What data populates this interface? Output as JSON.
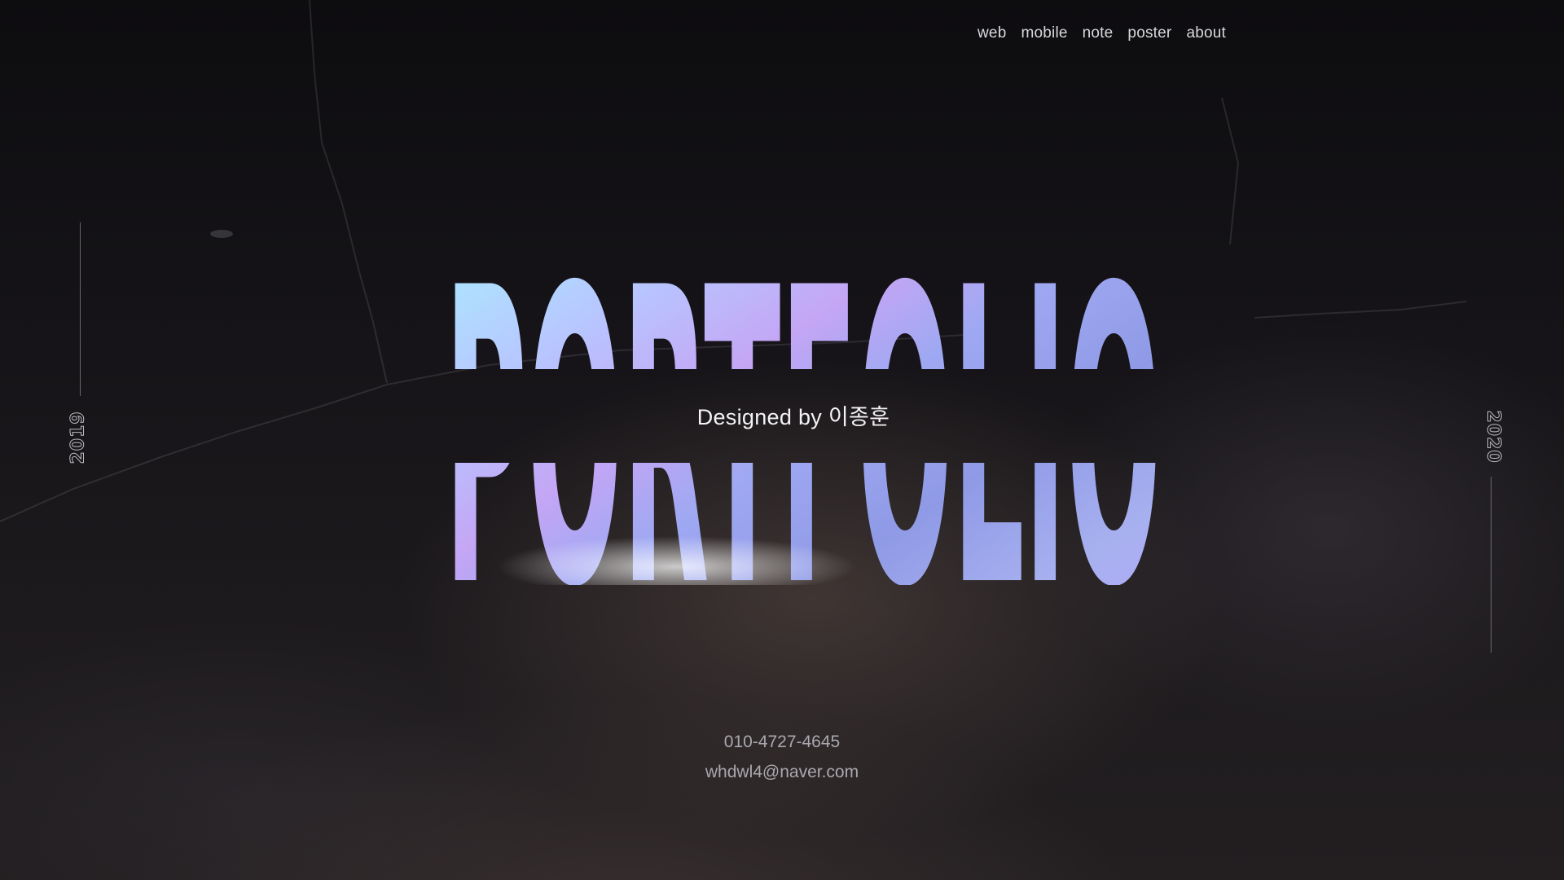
{
  "nav": {
    "items": [
      {
        "label": "web"
      },
      {
        "label": "mobile"
      },
      {
        "label": "note"
      },
      {
        "label": "poster"
      },
      {
        "label": "about"
      }
    ]
  },
  "hero": {
    "title": "PORTFOLIO",
    "subtitle": "Designed by 이종훈",
    "year_start": "2019",
    "year_end": "2020"
  },
  "contact": {
    "phone": "010-4727-4645",
    "email": "whdwl4@naver.com"
  },
  "colors": {
    "background": "#141215",
    "title_gradient": [
      "#a8f4ff",
      "#9fa8f2",
      "#c4a6f5",
      "#e8eef0",
      "#b7a9ff"
    ],
    "nav_text": "#d8d8dc",
    "contact_text": "#a8a8ae"
  }
}
